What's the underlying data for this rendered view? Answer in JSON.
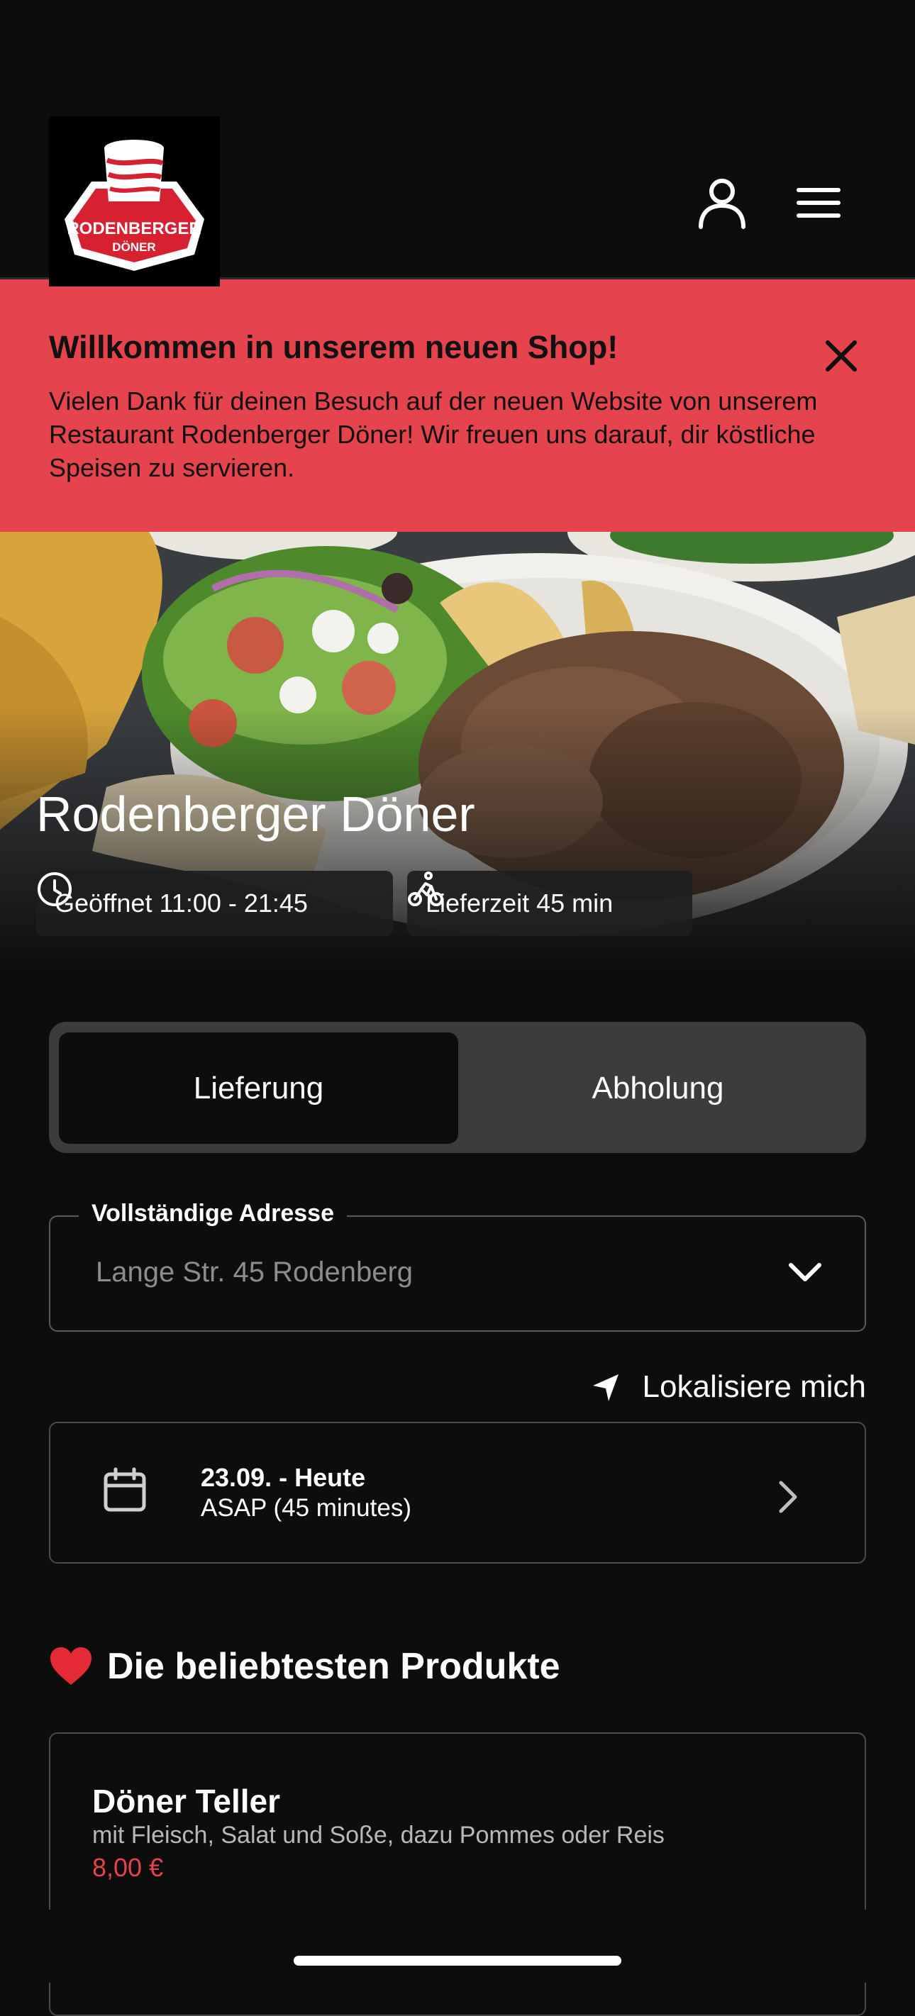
{
  "logo": {
    "line1": "RODENBERGER",
    "line2": "DÖNER"
  },
  "header": {
    "account_icon": "user-icon",
    "menu_icon": "hamburger-menu-icon"
  },
  "banner": {
    "title": "Willkommen in unserem neuen Shop!",
    "text": "Vielen Dank für deinen Besuch auf der neuen Website von unserem Restaurant Rodenberger Döner! Wir freuen uns darauf, dir köstliche Speisen zu servieren.",
    "close_icon": "close-icon",
    "color": "#e5434d"
  },
  "hero": {
    "title": "Rodenberger Döner",
    "opening": "Geöffnet 11:00 - 21:45",
    "delivery_time": "Lieferzeit 45 min"
  },
  "order_mode": {
    "options": [
      "Lieferung",
      "Abholung"
    ],
    "selected": "Lieferung"
  },
  "address": {
    "label": "Vollständige Adresse",
    "value": "Lange Str. 45 Rodenberg"
  },
  "locate": {
    "label": "Lokalisiere mich"
  },
  "schedule": {
    "date": "23.09. - Heute",
    "time": "ASAP (45 minutes)"
  },
  "popular": {
    "title": "Die beliebtesten Produkte",
    "products": [
      {
        "name": "Döner Teller",
        "description": "mit Fleisch, Salat und Soße, dazu Pommes oder Reis",
        "price": "8,00 €"
      }
    ]
  },
  "colors": {
    "background": "#0d0d0e",
    "accent": "#e5434d",
    "toggle_bg": "#3c3c3e"
  }
}
